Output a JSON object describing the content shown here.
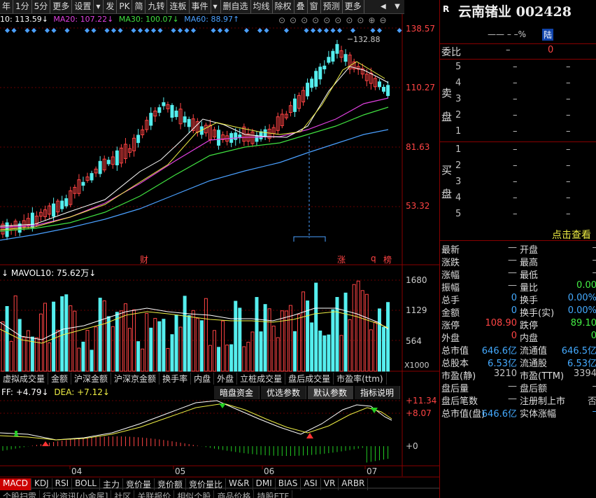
{
  "toolbar": {
    "items": [
      "年",
      "1分",
      "5分",
      "更多",
      "设置",
      "",
      "发",
      "PK",
      "简",
      "九转",
      "连板",
      "事件",
      "",
      "删自选",
      "均线",
      "除权",
      "叠",
      "窗",
      "预测",
      "更多"
    ]
  },
  "ma_line": {
    "ma10": "10: 113.59↓",
    "ma20": "MA20: 107.22↓",
    "ma30": "MA30: 100.07↓",
    "ma60": "MA60: 88.97↑"
  },
  "price_axis": [
    "138.57",
    "110.27",
    "81.63",
    "53.32"
  ],
  "peak": "132.88",
  "markers": {
    "cai": "财",
    "zhang": "涨",
    "q": "q",
    "bang": "榜"
  },
  "vol": {
    "label": "↓ MAVOL10: 75.62万↓",
    "axis": [
      "1680",
      "1129",
      "564"
    ],
    "unit": "X1000"
  },
  "tabs1": [
    "虚拟成交量",
    "金额",
    "沪深金额",
    "沪深京金额",
    "换手率",
    "内盘",
    "外盘",
    "立桩成交量",
    "盘后成交量",
    "市盈率(ttm)"
  ],
  "macd": {
    "label_diff": "FF: +4.79↓",
    "label_dea": "DEA: +7.12↓",
    "buttons": [
      "暗盘资金",
      "优选参数",
      "默认参数",
      "指标说明"
    ],
    "axis": [
      "+11.34",
      "+8.07",
      "+0"
    ]
  },
  "months": [
    "04",
    "05",
    "06",
    "07"
  ],
  "tabs2": [
    "MACD",
    "KDJ",
    "RSI",
    "BOLL",
    "主力",
    "竞价量",
    "竞价额",
    "竞价量比",
    "W&R",
    "DMI",
    "BIAS",
    "ASI",
    "VR",
    "ARBR"
  ],
  "tabs3": [
    "个股扫雷",
    "行业资讯[小金属]",
    "社区",
    "关联报价",
    "相似个股",
    "商品价格",
    "持股ETF"
  ],
  "right": {
    "R": "R",
    "stock": "云南锗业 002428",
    "sub": "—— – –%",
    "lu": "陆",
    "weibi": "委比",
    "weibi_v1": "–",
    "weibi_v2": "0",
    "sell": "卖盘",
    "buy": "买盘",
    "levels": [
      "5",
      "4",
      "3",
      "2",
      "1"
    ],
    "dash": "–",
    "click": "点击查看",
    "stats": [
      [
        "最新",
        "—",
        "开盘",
        "–"
      ],
      [
        "涨跌",
        "—",
        "最高",
        "–"
      ],
      [
        "涨幅",
        "—",
        "最低",
        "–"
      ],
      [
        "振幅",
        "—",
        "量比",
        "0.00"
      ],
      [
        "总手",
        "0",
        "换手",
        "0.00%"
      ],
      [
        "金额",
        "0",
        "换手(实)",
        "0.00%"
      ],
      [
        "涨停",
        "108.90",
        "跌停",
        "89.10"
      ],
      [
        "外盘",
        "0",
        "内盘",
        "0"
      ],
      [
        "总市值",
        "646.6亿",
        "流通值",
        "646.5亿"
      ],
      [
        "总股本",
        "6.53亿",
        "流通股",
        "6.53亿"
      ],
      [
        "市盈(静)",
        "3210",
        "市盈(TTM)",
        "3394"
      ],
      [
        "盘后量",
        "—",
        "盘后额",
        "–"
      ],
      [
        "盘后笔数",
        "—",
        "注册制上市",
        "否"
      ],
      [
        "总市值(盘)",
        "646.6亿",
        "实体涨幅",
        "–"
      ]
    ]
  }
}
